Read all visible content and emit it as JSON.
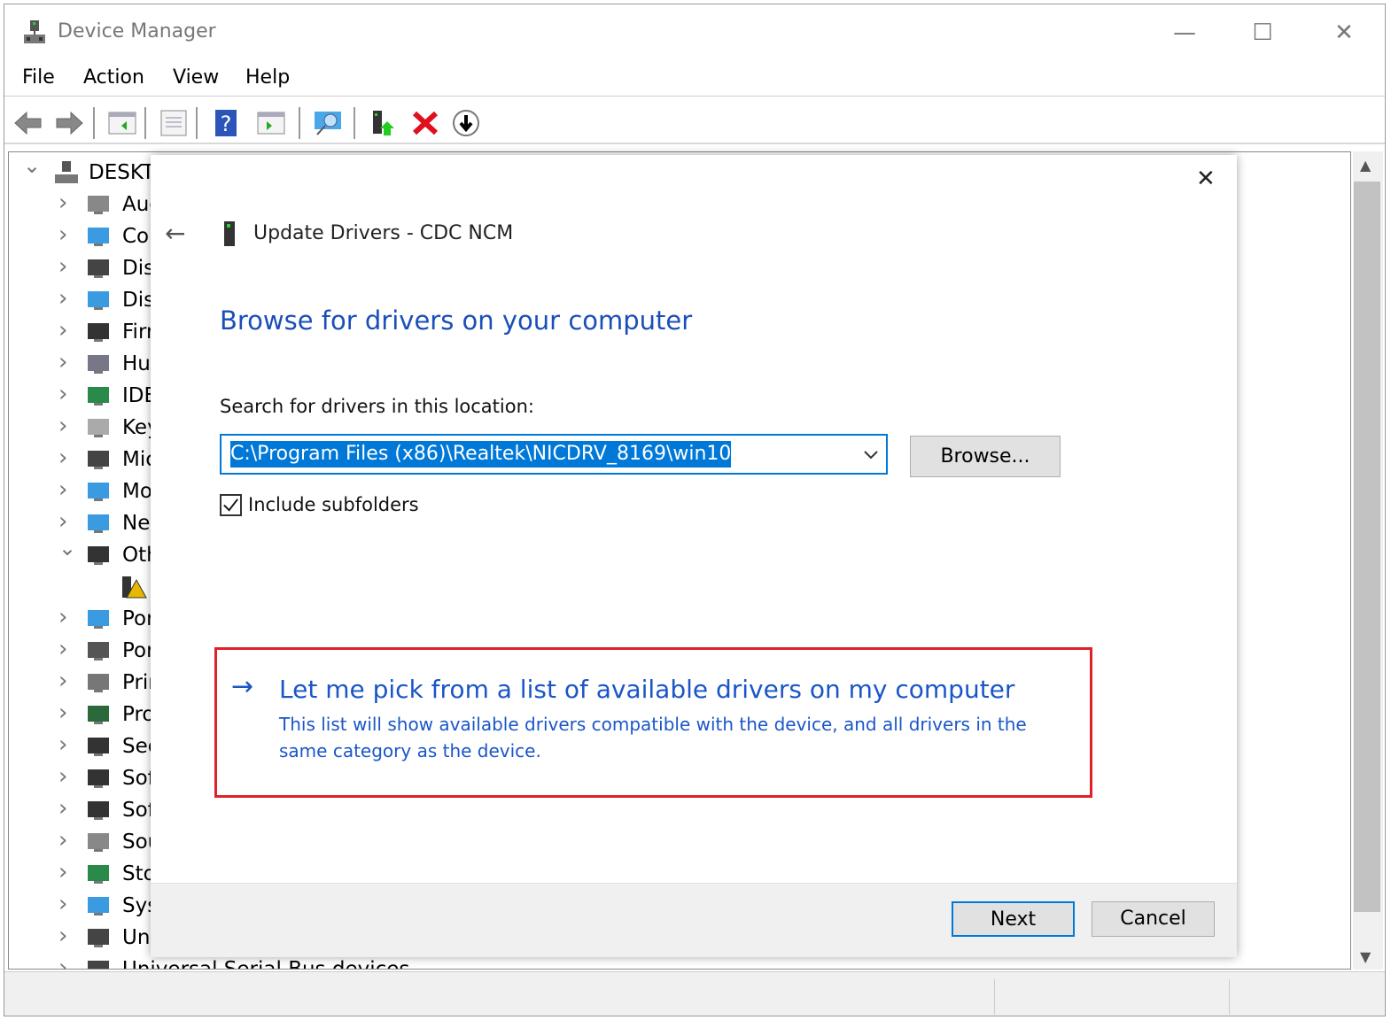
{
  "window": {
    "title": "Device Manager",
    "minimize": "—",
    "maximize": "☐",
    "close": "✕"
  },
  "menu": [
    "File",
    "Action",
    "View",
    "Help"
  ],
  "toolbar": [
    "back-icon",
    "forward-icon",
    "show-hide-console-tree-icon",
    "properties-icon",
    "help-icon",
    "show-action-pane-icon",
    "scan-hardware-icon",
    "update-driver-icon",
    "uninstall-icon",
    "disable-icon"
  ],
  "tree": {
    "root": "DESKTO",
    "items": [
      {
        "label": "Auc",
        "icon": "audio-icon",
        "expanded": false
      },
      {
        "label": "Cor",
        "icon": "computer-icon",
        "expanded": false
      },
      {
        "label": "Disl",
        "icon": "disk-icon",
        "expanded": false
      },
      {
        "label": "Disp",
        "icon": "display-adapter-icon",
        "expanded": false
      },
      {
        "label": "Firr",
        "icon": "firmware-icon",
        "expanded": false
      },
      {
        "label": "Hui",
        "icon": "hid-icon",
        "expanded": false
      },
      {
        "label": "IDE",
        "icon": "ide-icon",
        "expanded": false
      },
      {
        "label": "Key",
        "icon": "keyboard-icon",
        "expanded": false
      },
      {
        "label": "Mic",
        "icon": "mouse-icon",
        "expanded": false
      },
      {
        "label": "Mo",
        "icon": "monitor-icon",
        "expanded": false
      },
      {
        "label": "Net",
        "icon": "network-icon",
        "expanded": false
      },
      {
        "label": "Oth",
        "icon": "other-devices-icon",
        "expanded": true
      },
      {
        "label": "",
        "icon": "unknown-device-warning-icon",
        "child": true
      },
      {
        "label": "Por",
        "icon": "portable-device-icon",
        "expanded": false
      },
      {
        "label": "Por",
        "icon": "ports-icon",
        "expanded": false
      },
      {
        "label": "Prir",
        "icon": "printer-icon",
        "expanded": false
      },
      {
        "label": "Pro",
        "icon": "processor-icon",
        "expanded": false
      },
      {
        "label": "Sec",
        "icon": "security-icon",
        "expanded": false
      },
      {
        "label": "Sof",
        "icon": "software-component-icon",
        "expanded": false
      },
      {
        "label": "Sof",
        "icon": "software-device-icon",
        "expanded": false
      },
      {
        "label": "Sou",
        "icon": "sound-icon",
        "expanded": false
      },
      {
        "label": "Sto",
        "icon": "storage-icon",
        "expanded": false
      },
      {
        "label": "Sys",
        "icon": "system-icon",
        "expanded": false
      },
      {
        "label": "Uni",
        "icon": "usb-icon",
        "expanded": false
      },
      {
        "label": "Universal Serial Bus devices",
        "icon": "usb-device-icon",
        "expanded": false
      }
    ]
  },
  "dialog": {
    "header": "Update Drivers - CDC NCM",
    "heading": "Browse for drivers on your computer",
    "search_label": "Search for drivers in this location:",
    "path_value": "C:\\Program Files (x86)\\Realtek\\NICDRV_8169\\win10",
    "browse": "Browse...",
    "include_subfolders": "Include subfolders",
    "include_checked": true,
    "pick_title": "Let me pick from a list of available drivers on my computer",
    "pick_desc_1": "This list will show available drivers compatible with the device, and all drivers in the",
    "pick_desc_2": "same category as the device.",
    "next": "Next",
    "cancel": "Cancel",
    "close": "✕",
    "back": "←",
    "arrow": "→"
  },
  "colors": {
    "accent": "#0066cc",
    "link": "#1a56c8",
    "highlight_border": "#e0202a",
    "selection": "#0078d7"
  }
}
